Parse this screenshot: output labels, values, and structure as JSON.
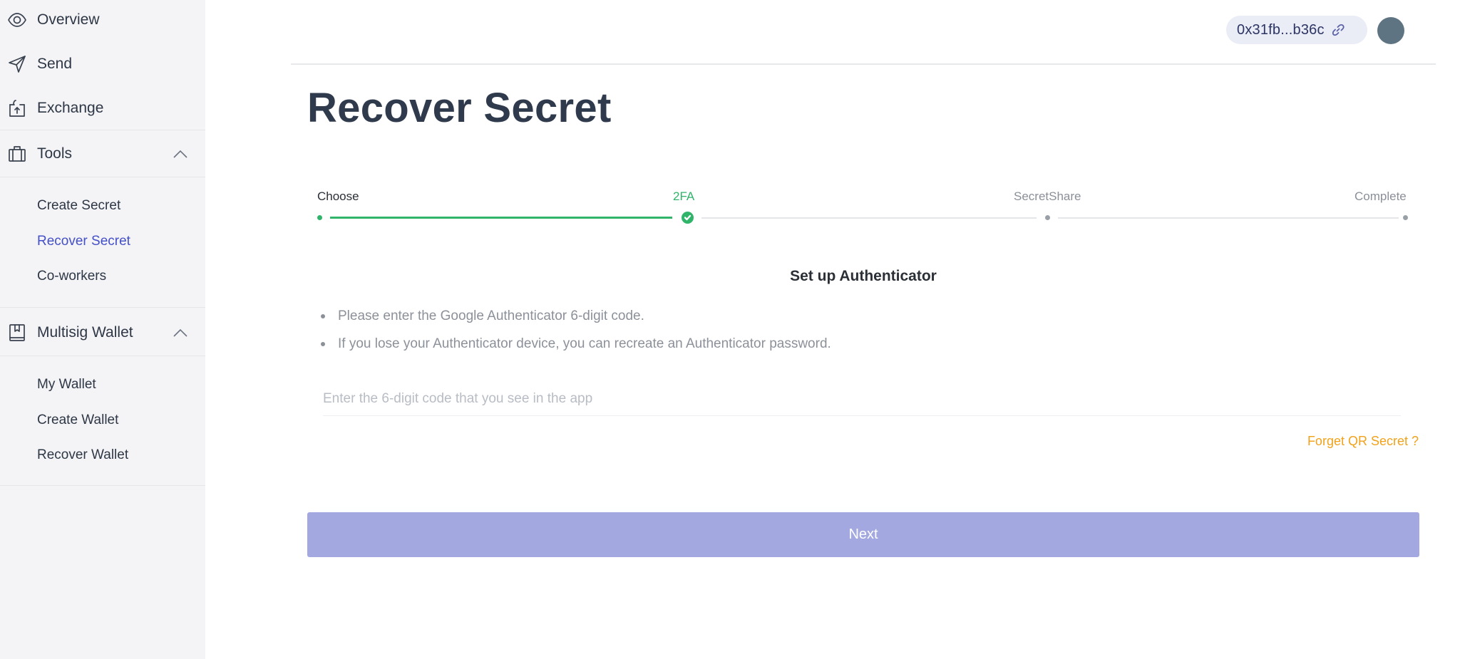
{
  "sidebar": {
    "items": [
      {
        "label": "Overview",
        "icon": "eye-icon"
      },
      {
        "label": "Send",
        "icon": "send-icon"
      },
      {
        "label": "Exchange",
        "icon": "exchange-icon"
      }
    ],
    "tools": {
      "label": "Tools",
      "icon": "toolbox-icon",
      "expanded": true,
      "children": [
        "Create Secret",
        "Recover Secret",
        "Co-workers"
      ],
      "active": "Recover Secret"
    },
    "multisig": {
      "label": "Multisig Wallet",
      "icon": "book-icon",
      "expanded": true,
      "children": [
        "My Wallet",
        "Create Wallet",
        "Recover Wallet"
      ]
    }
  },
  "header": {
    "address": "0x31fb...b36c",
    "address_icon": "link-icon",
    "avatar": "avatar"
  },
  "main": {
    "title": "Recover Secret",
    "steps": [
      {
        "label": "Choose",
        "status": "done"
      },
      {
        "label": "2FA",
        "status": "current"
      },
      {
        "label": "SecretShare",
        "status": "pending"
      },
      {
        "label": "Complete",
        "status": "pending"
      }
    ],
    "section_title": "Set up Authenticator",
    "bullets": [
      "Please enter the Google Authenticator 6-digit code.",
      "If you lose your Authenticator device, you can recreate an Authenticator password."
    ],
    "code_input": {
      "value": "",
      "placeholder": "Enter the 6-digit code that you see in the app"
    },
    "forget_link": "Forget QR Secret ?",
    "next_button": "Next"
  },
  "colors": {
    "accent": "#4450c8",
    "success": "#2fb46a",
    "warning": "#f0a21b",
    "button_disabled": "#a3a9e0",
    "sidebar_bg": "#f4f4f6"
  }
}
